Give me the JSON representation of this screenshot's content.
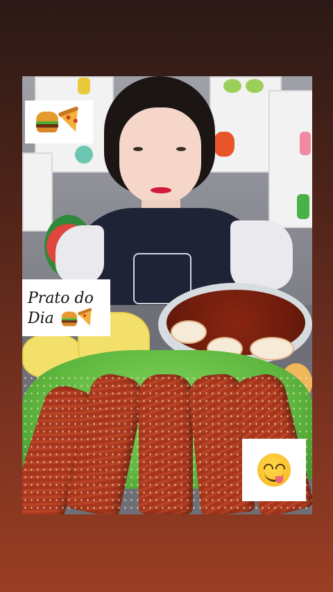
{
  "stickers": {
    "top_left": {
      "emojis": [
        "burger",
        "pizza"
      ]
    },
    "prato": {
      "line1": "Prato do",
      "line2": "Dia",
      "emojis": [
        "burger",
        "pizza"
      ]
    },
    "bottom_right": {
      "emoji": "smiley-tongue"
    }
  },
  "colors": {
    "background_top": "#2b1a17",
    "background_bottom": "#9a3e24",
    "sticker_bg": "#ffffff"
  }
}
